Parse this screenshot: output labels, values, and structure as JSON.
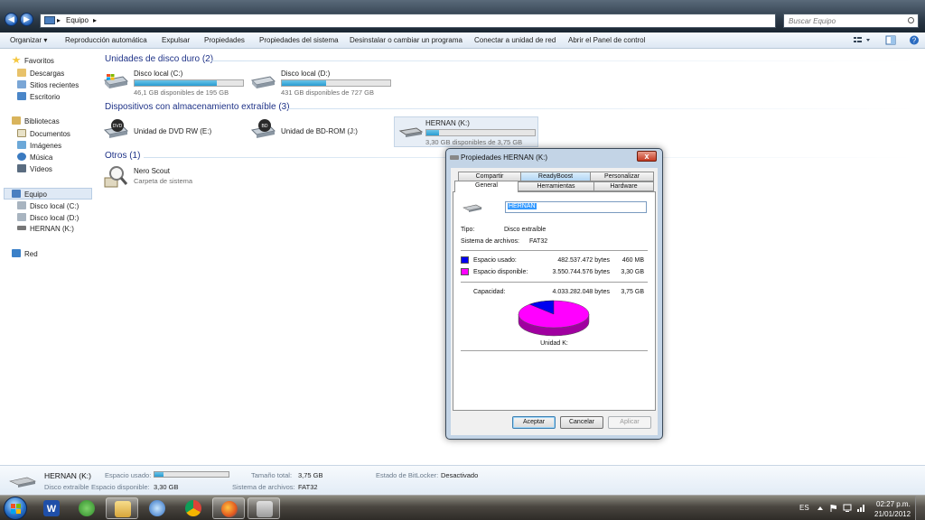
{
  "address": {
    "breadcrumb": "Equipo",
    "search_placeholder": "Buscar Equipo"
  },
  "toolbar": {
    "organize": "Organizar",
    "autoplay": "Reproducción automática",
    "eject": "Expulsar",
    "properties": "Propiedades",
    "system_properties": "Propiedades del sistema",
    "uninstall": "Desinstalar o cambiar un programa",
    "map_drive": "Conectar a unidad de red",
    "control_panel": "Abrir el Panel de control"
  },
  "nav": {
    "favorites": "Favoritos",
    "downloads": "Descargas",
    "recent": "Sitios recientes",
    "desktop": "Escritorio",
    "libraries": "Bibliotecas",
    "documents": "Documentos",
    "images": "Imágenes",
    "music": "Música",
    "videos": "Vídeos",
    "computer": "Equipo",
    "disk_c": "Disco local (C:)",
    "disk_d": "Disco local (D:)",
    "hernan": "HERNAN (K:)",
    "network": "Red"
  },
  "groups": {
    "hdd": "Unidades de disco duro (2)",
    "removable": "Dispositivos con almacenamiento extraíble (3)",
    "others": "Otros (1)"
  },
  "drives": {
    "c": {
      "name": "Disco local (C:)",
      "sub": "46,1 GB disponibles de 195 GB",
      "used_fraction": 0.76
    },
    "d": {
      "name": "Disco local (D:)",
      "sub": "431 GB disponibles de 727 GB",
      "used_fraction": 0.41
    },
    "dvd": {
      "name": "Unidad de DVD RW (E:)"
    },
    "bd": {
      "name": "Unidad de BD-ROM (J:)"
    },
    "k": {
      "name": "HERNAN (K:)",
      "sub": "3,30 GB disponibles de 3,75 GB",
      "used_fraction": 0.12
    },
    "nero": {
      "name": "Nero Scout",
      "sub": "Carpeta de sistema"
    }
  },
  "details": {
    "name": "HERNAN (K:)",
    "type": "Disco extraíble",
    "used_label": "Espacio usado:",
    "used_fraction": 0.12,
    "free_label": "Espacio disponible:",
    "free_value": "3,30 GB",
    "total_label": "Tamaño total:",
    "total_value": "3,75 GB",
    "fs_label": "Sistema de archivos:",
    "fs_value": "FAT32",
    "bitlocker_label": "Estado de BitLocker:",
    "bitlocker_value": "Desactivado"
  },
  "dialog": {
    "title": "Propiedades  HERNAN (K:)",
    "close": "x",
    "tabs": {
      "compartir": "Compartir",
      "readyboost": "ReadyBoost",
      "personalizar": "Personalizar",
      "general": "General",
      "herramientas": "Herramientas",
      "hardware": "Hardware"
    },
    "volume_name": "HERNAN",
    "type_label": "Tipo:",
    "type_value": "Disco extraíble",
    "fs_label": "Sistema de archivos:",
    "fs_value": "FAT32",
    "used_label": "Espacio usado:",
    "used_bytes": "482.537.472 bytes",
    "used_size": "460 MB",
    "free_label": "Espacio disponible:",
    "free_bytes": "3.550.744.576 bytes",
    "free_size": "3,30 GB",
    "capacity_label": "Capacidad:",
    "capacity_bytes": "4.033.282.048 bytes",
    "capacity_size": "3,75 GB",
    "pie_used_fraction": 0.12,
    "drive_label": "Unidad K:",
    "used_color": "#0000f0",
    "free_color": "#ff00ff",
    "ok": "Aceptar",
    "cancel": "Cancelar",
    "apply": "Aplicar"
  },
  "tray": {
    "lang": "ES",
    "time": "02:27 p.m.",
    "date": "21/01/2012"
  }
}
